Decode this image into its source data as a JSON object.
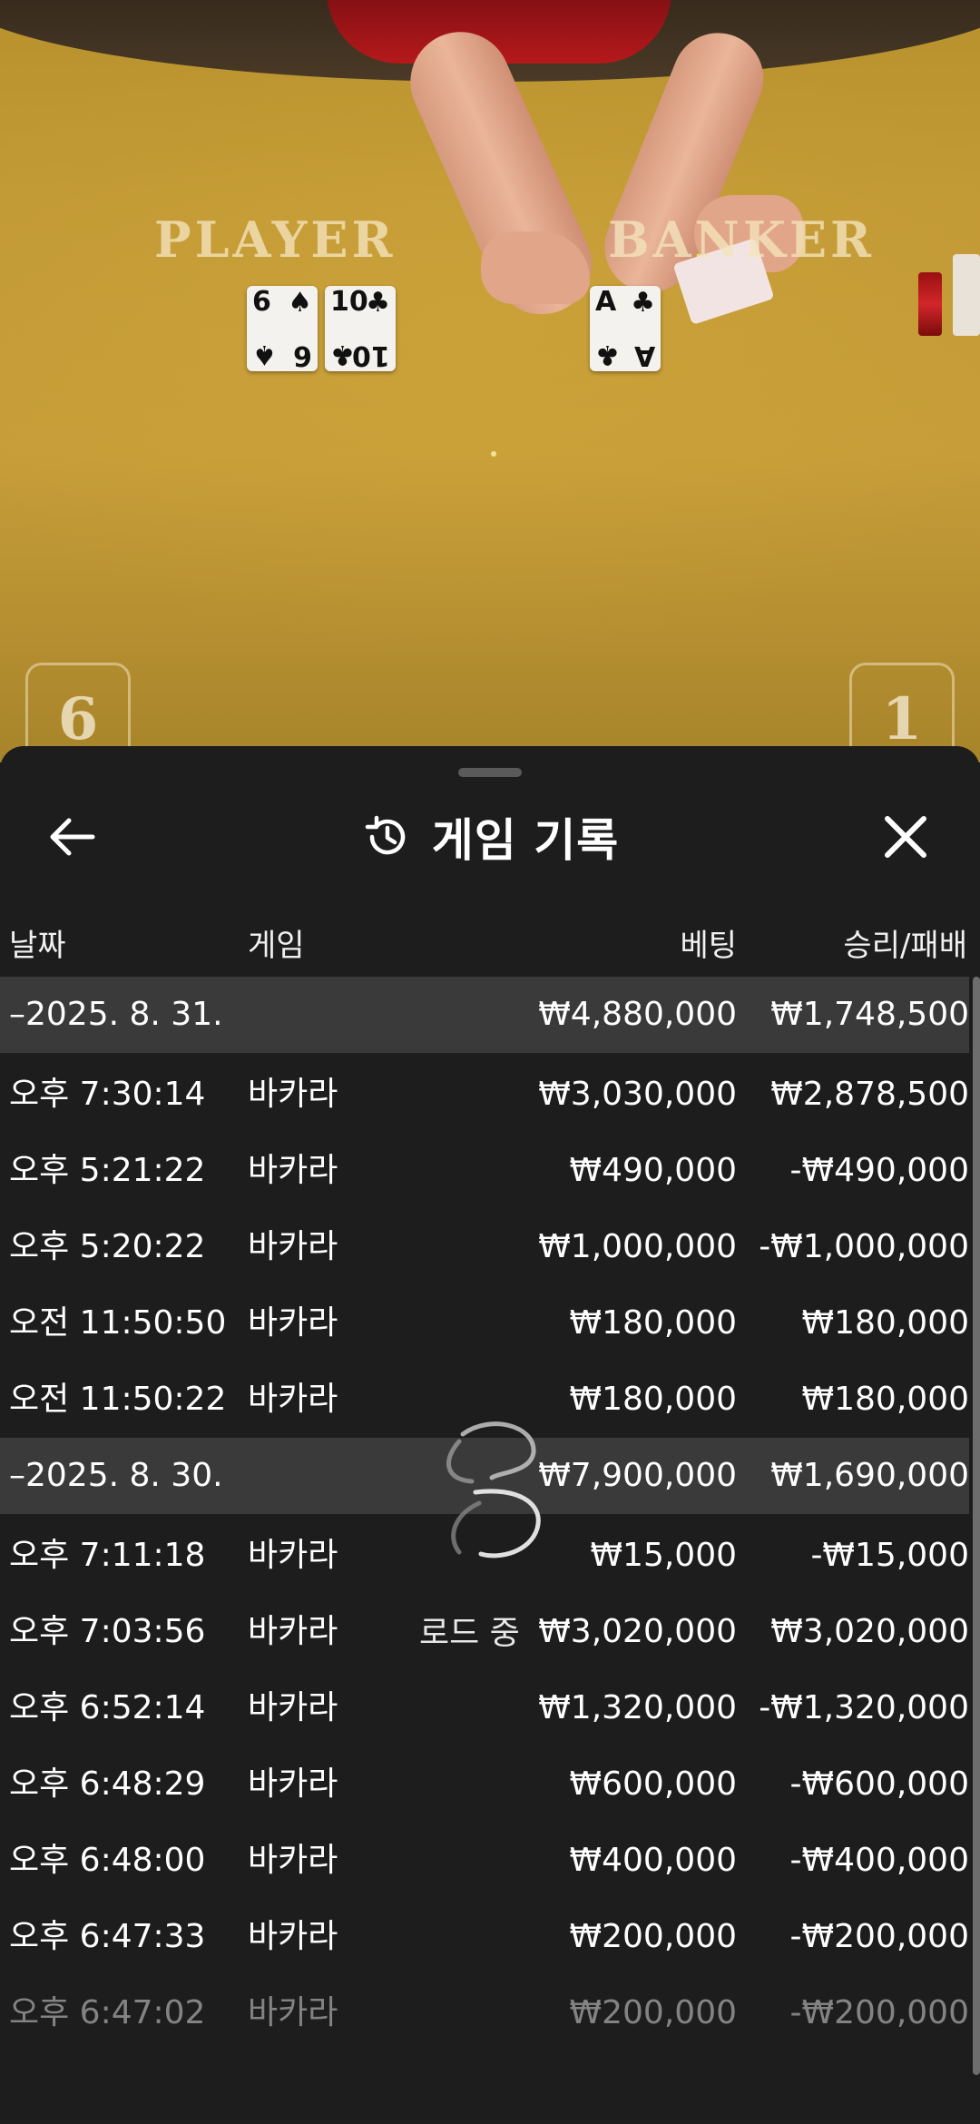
{
  "game_view": {
    "player_label": "PLAYER",
    "banker_label": "BANKER",
    "player_score": "6",
    "banker_score": "1",
    "player_cards": [
      {
        "rank": "6",
        "suit": "♠"
      },
      {
        "rank": "10",
        "suit": "♣"
      }
    ],
    "banker_cards": [
      {
        "rank": "A",
        "suit": "♣"
      }
    ]
  },
  "sheet": {
    "title": "게임 기록",
    "back_icon": "arrow-left-icon",
    "title_icon": "history-icon",
    "close_icon": "close-icon",
    "columns": {
      "date": "날짜",
      "game": "게임",
      "bet": "베팅",
      "result": "승리/패배"
    },
    "groups": [
      {
        "date": "–2025. 8. 31.",
        "bet_total": "₩4,880,000",
        "result_total": "₩1,748,500",
        "rows": [
          {
            "time": "오후 7:30:14",
            "game": "바카라",
            "bet": "₩3,030,000",
            "result": "₩2,878,500"
          },
          {
            "time": "오후 5:21:22",
            "game": "바카라",
            "bet": "₩490,000",
            "result": "-₩490,000"
          },
          {
            "time": "오후 5:20:22",
            "game": "바카라",
            "bet": "₩1,000,000",
            "result": "-₩1,000,000"
          },
          {
            "time": "오전 11:50:50",
            "game": "바카라",
            "bet": "₩180,000",
            "result": "₩180,000"
          },
          {
            "time": "오전 11:50:22",
            "game": "바카라",
            "bet": "₩180,000",
            "result": "₩180,000"
          }
        ]
      },
      {
        "date": "–2025. 8. 30.",
        "bet_total": "₩7,900,000",
        "result_total": "₩1,690,000",
        "rows": [
          {
            "time": "오후 7:11:18",
            "game": "바카라",
            "bet": "₩15,000",
            "result": "-₩15,000"
          },
          {
            "time": "오후 7:03:56",
            "game": "바카라",
            "bet": "₩3,020,000",
            "result": "₩3,020,000"
          },
          {
            "time": "오후 6:52:14",
            "game": "바카라",
            "bet": "₩1,320,000",
            "result": "-₩1,320,000"
          },
          {
            "time": "오후 6:48:29",
            "game": "바카라",
            "bet": "₩600,000",
            "result": "-₩600,000"
          },
          {
            "time": "오후 6:48:00",
            "game": "바카라",
            "bet": "₩400,000",
            "result": "-₩400,000"
          },
          {
            "time": "오후 6:47:33",
            "game": "바카라",
            "bet": "₩200,000",
            "result": "-₩200,000"
          },
          {
            "time": "오후 6:47:02",
            "game": "바카라",
            "bet": "₩200,000",
            "result": "-₩200,000"
          }
        ]
      }
    ],
    "loading_text": "로드 중",
    "loading_icon": "loading-spinner-icon"
  }
}
